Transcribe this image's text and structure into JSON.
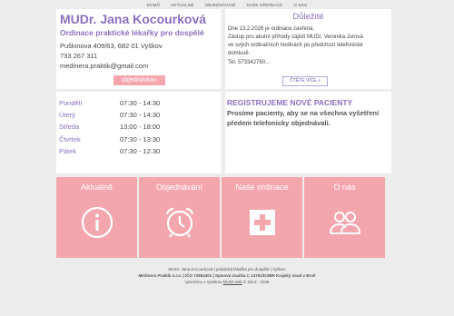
{
  "nav": {
    "items": [
      "Domů",
      "Aktuálně",
      "Objednávání",
      "Naše ordinace",
      "O nás"
    ]
  },
  "contact": {
    "name": "MUDr. Jana Kocourková",
    "subtitle": "Ordinace praktické lékařky pro dospělé",
    "address": "Puškinova 409/63, 682 01 Vyškov",
    "phone": "733 267 311",
    "email": "medinera.praktik@gmail.com",
    "order_button": "objednávka»"
  },
  "news": {
    "title": "Důležité",
    "lines": [
      "Dne 13.2.2026 je ordinace zavřená.",
      "Zástup pro akutní příhody zajistí MUDr. Veronika Jurová",
      "ve svých ordinačních hodinách po předchozí telefonické",
      "domluvě.",
      "Tel. 573342760..."
    ],
    "more_button": "ČTĚTE VÍCE »"
  },
  "hours": [
    {
      "day": "Pondělí",
      "time": "07:30 - 14:30"
    },
    {
      "day": "Úterý",
      "time": "07:30 - 14:30"
    },
    {
      "day": "Středa",
      "time": "13:00 - 18:00"
    },
    {
      "day": "Čtvrtek",
      "time": "07:30 - 13:30"
    },
    {
      "day": "Pátek",
      "time": "07:30 - 12:30"
    }
  ],
  "patients": {
    "title": "REGISTRUJEME NOVÉ PACIENTY",
    "lines": [
      "Prosíme pacienty, aby se na všechna vyšetření",
      "předem telefonicky objednávali."
    ]
  },
  "tiles": [
    {
      "label": "Aktuálně",
      "icon": "info-icon"
    },
    {
      "label": "Objednávání",
      "icon": "alarm-clock-icon"
    },
    {
      "label": "Naše ordinace",
      "icon": "medical-cross-icon"
    },
    {
      "label": "O nás",
      "icon": "people-icon"
    }
  ],
  "footer": {
    "line1": "MUDr. Jana Kocourková | praktická lékařka pro dospělé | Vyškov",
    "line2": "Medinera Praktik s.r.o. | IČO 72854301 | Spisová značka C 13791/KSBR Krajský soud v Brně",
    "line3_prefix": "vytvořeno v systému ",
    "line3_link": "MUDr.web",
    "line3_suffix": " © 2013 - 2026"
  },
  "colors": {
    "accent": "#8a6fbf",
    "tile": "#f4a6ad",
    "background": "#ececec"
  }
}
